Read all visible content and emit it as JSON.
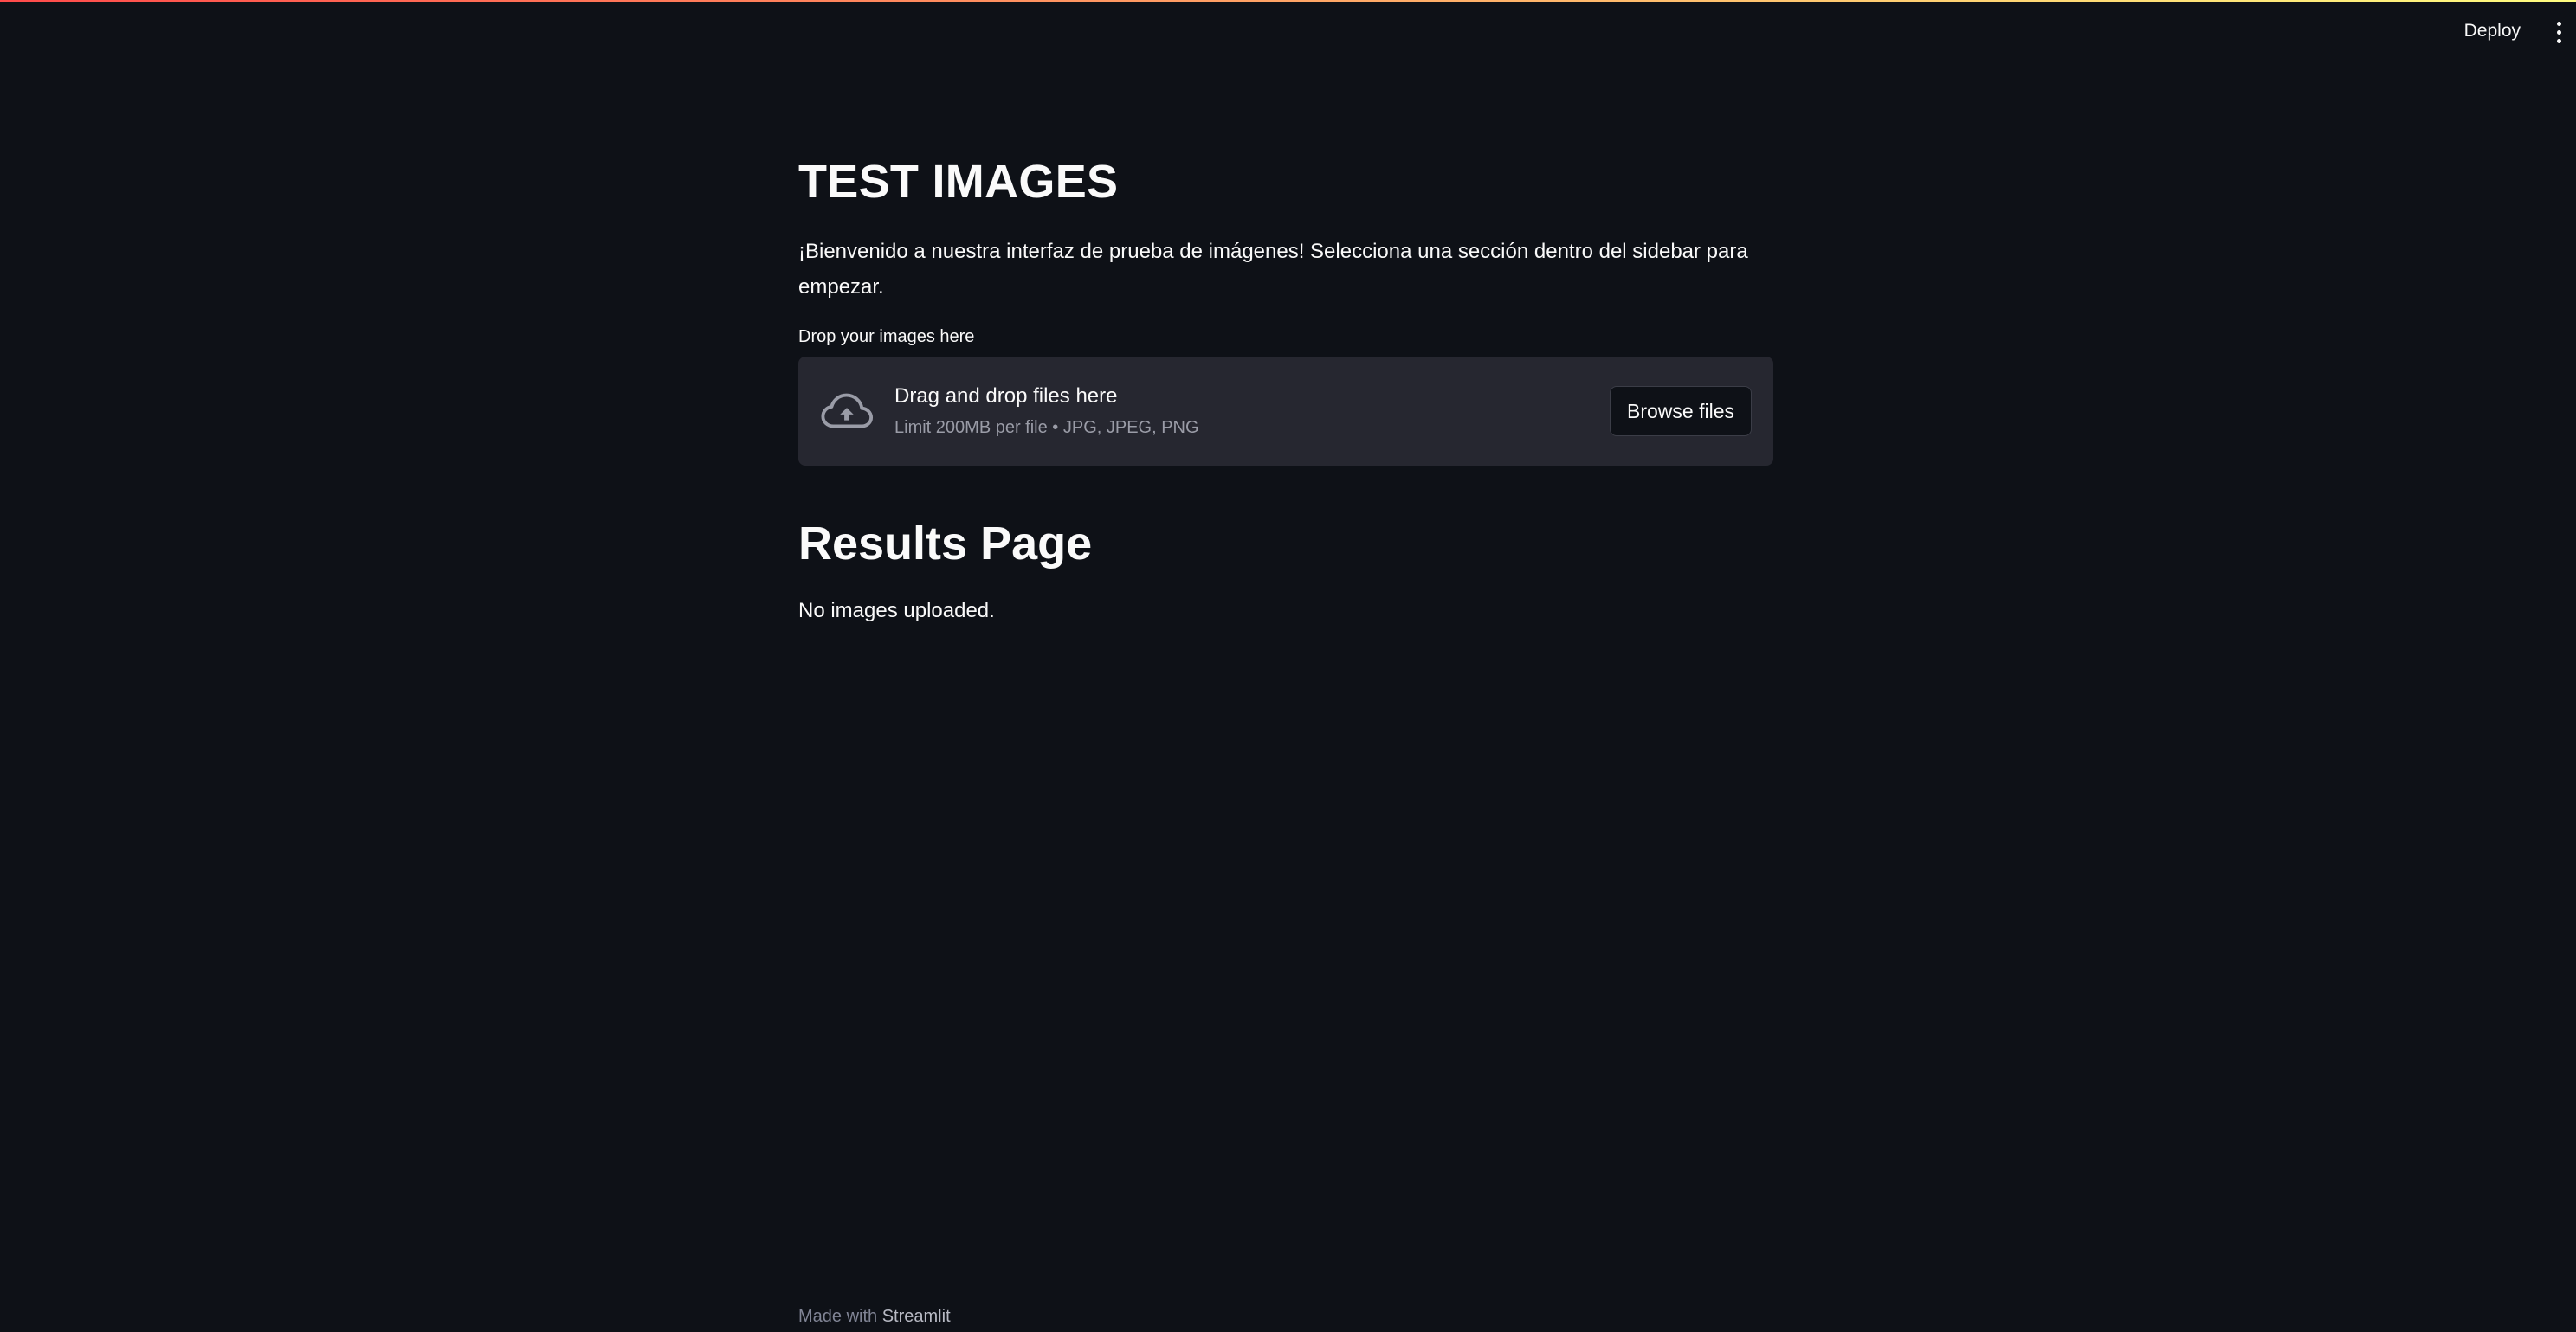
{
  "header": {
    "deploy_label": "Deploy",
    "menu_icon": "vertical-ellipsis-icon"
  },
  "main": {
    "title": "TEST IMAGES",
    "intro": "¡Bienvenido a nuestra interfaz de prueba de imágenes! Selecciona una sección dentro del sidebar para empezar.",
    "uploader": {
      "label": "Drop your images here",
      "icon": "cloud-upload-icon",
      "drop_text": "Drag and drop files here",
      "limit_text": "Limit 200MB per file • JPG, JPEG, PNG",
      "browse_label": "Browse files"
    },
    "results": {
      "title": "Results Page",
      "message": "No images uploaded."
    }
  },
  "footer": {
    "prefix": "Made with",
    "brand": "Streamlit"
  },
  "colors": {
    "background": "#0e1117",
    "surface": "#262730",
    "text": "#fafafa",
    "muted": "#9a9ca7"
  }
}
